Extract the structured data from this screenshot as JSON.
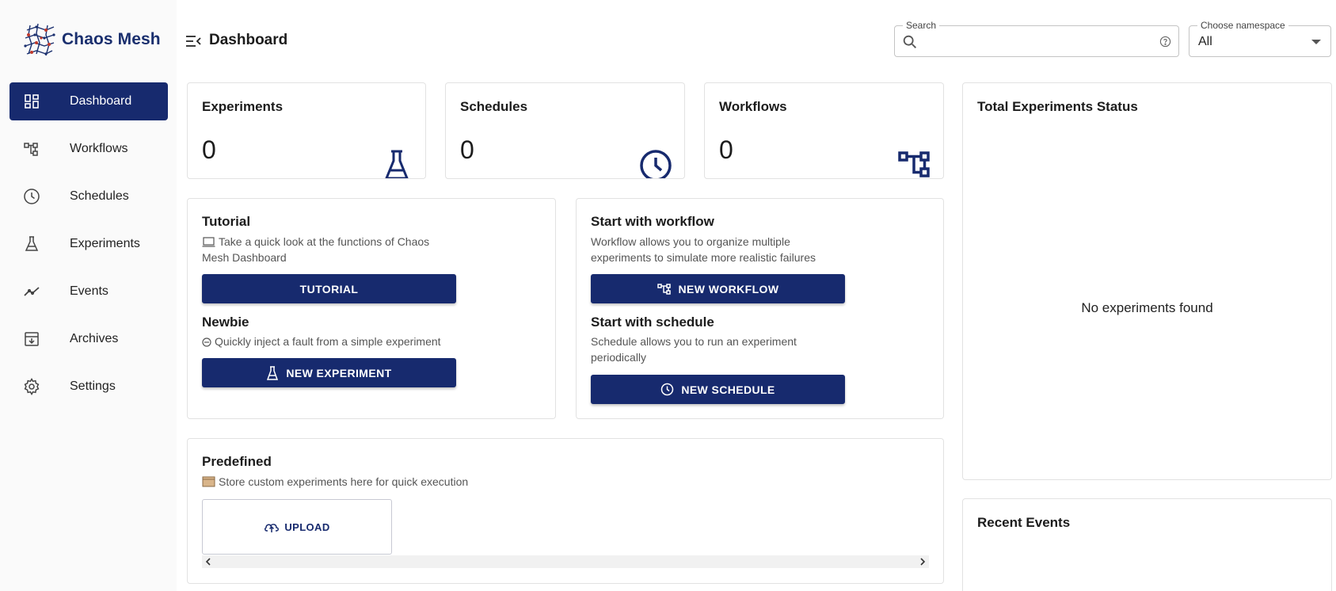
{
  "app": {
    "name": "Chaos Mesh"
  },
  "sidebar": {
    "items": [
      {
        "label": "Dashboard",
        "icon": "dashboard-icon",
        "active": true
      },
      {
        "label": "Workflows",
        "icon": "workflow-icon"
      },
      {
        "label": "Schedules",
        "icon": "clock-icon"
      },
      {
        "label": "Experiments",
        "icon": "flask-icon"
      },
      {
        "label": "Events",
        "icon": "timeline-icon"
      },
      {
        "label": "Archives",
        "icon": "archive-icon"
      },
      {
        "label": "Settings",
        "icon": "gear-icon"
      }
    ]
  },
  "header": {
    "title": "Dashboard",
    "search": {
      "label": "Search",
      "value": ""
    },
    "namespace": {
      "label": "Choose namespace",
      "value": "All"
    }
  },
  "stats": {
    "experiments": {
      "title": "Experiments",
      "value": "0"
    },
    "schedules": {
      "title": "Schedules",
      "value": "0"
    },
    "workflows": {
      "title": "Workflows",
      "value": "0"
    }
  },
  "tutorial": {
    "title": "Tutorial",
    "desc": "Take a quick look at the functions of Chaos Mesh Dashboard",
    "button": "TUTORIAL"
  },
  "newbie": {
    "title": "Newbie",
    "desc": "Quickly inject a fault from a simple experiment",
    "button": "NEW EXPERIMENT"
  },
  "workflow_start": {
    "title": "Start with workflow",
    "desc": "Workflow allows you to organize multiple experiments to simulate more realistic failures",
    "button": "NEW WORKFLOW"
  },
  "schedule_start": {
    "title": "Start with schedule",
    "desc": "Schedule allows you to run an experiment periodically",
    "button": "NEW SCHEDULE"
  },
  "predefined": {
    "title": "Predefined",
    "desc": "Store custom experiments here for quick execution",
    "upload": "UPLOAD"
  },
  "status": {
    "title": "Total Experiments Status",
    "empty": "No experiments found"
  },
  "events": {
    "title": "Recent Events"
  },
  "colors": {
    "primary": "#172a6e",
    "sidebar_bg": "#fafafa",
    "border": "#e2e2e2"
  }
}
